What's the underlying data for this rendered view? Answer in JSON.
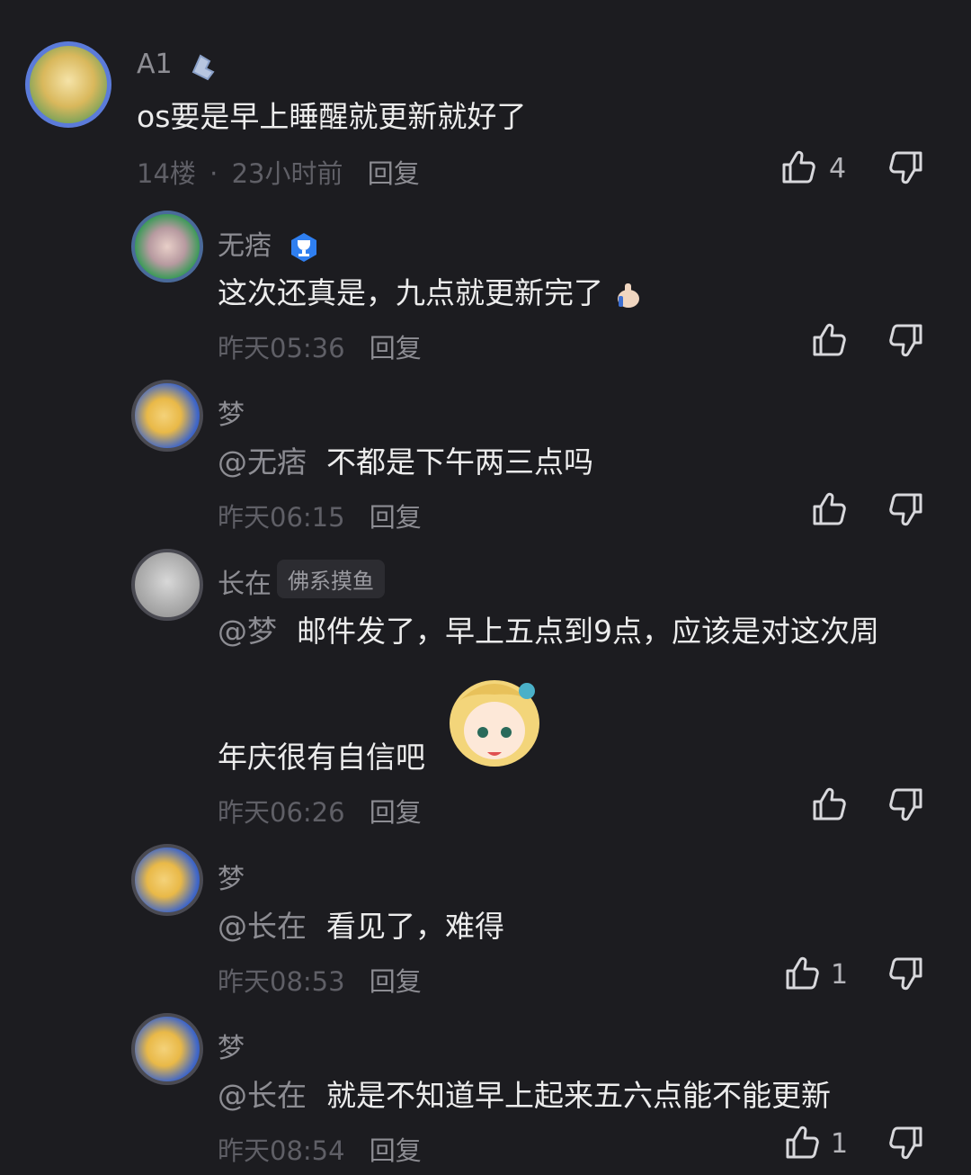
{
  "comments": [
    {
      "user": "A1",
      "text": "os要是早上睡醒就更新就好了",
      "floor": "14楼",
      "sep": "·",
      "time": "23小时前",
      "reply": "回复",
      "likes": "4"
    },
    {
      "user": "无痞",
      "text": "这次还真是，九点就更新完了",
      "time": "昨天05:36",
      "reply": "回复"
    },
    {
      "user": "梦",
      "mention": "@无痞",
      "text": "不都是下午两三点吗",
      "time": "昨天06:15",
      "reply": "回复"
    },
    {
      "user": "长在",
      "tag": "佛系摸鱼",
      "mention": "@梦",
      "text": "邮件发了，早上五点到9点，应该是对这次周",
      "text2": "年庆很有自信吧",
      "time": "昨天06:26",
      "reply": "回复"
    },
    {
      "user": "梦",
      "mention": "@长在",
      "text": "看见了，难得",
      "time": "昨天08:53",
      "reply": "回复",
      "likes": "1"
    },
    {
      "user": "梦",
      "mention": "@长在",
      "text": "就是不知道早上起来五六点能不能更新",
      "time": "昨天08:54",
      "reply": "回复",
      "likes": "1"
    }
  ],
  "colors": {
    "background": "#1c1c20",
    "name": "#8d8d93",
    "text": "#ececec",
    "meta": "#5f5f66",
    "badge": "#2f7ff0"
  }
}
